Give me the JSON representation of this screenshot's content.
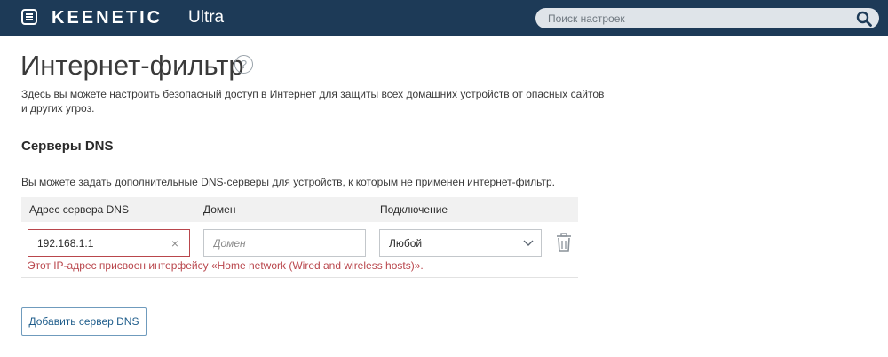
{
  "header": {
    "brand": "KEENETIC",
    "model": "Ultra",
    "search_placeholder": "Поиск настроек",
    "search_value": ""
  },
  "page": {
    "title": "Интернет-фильтр",
    "help_symbol": "?",
    "description": "Здесь вы можете настроить безопасный доступ в Интернет для защиты всех домашних устройств от опасных сайтов и других угроз."
  },
  "dns_section": {
    "title": "Серверы DNS",
    "note": "Вы можете задать дополнительные DNS-серверы для устройств, к которым не применен интернет-фильтр.",
    "columns": [
      "Адрес сервера DNS",
      "Домен",
      "Подключение"
    ],
    "rows": [
      {
        "address_value": "192.168.1.1",
        "domain_value": "",
        "domain_placeholder": "Домен",
        "connection_value": "Любой",
        "error": "Этот IP-адрес присвоен интерфейсу «Home network (Wired and wireless hosts)»."
      }
    ],
    "clear_symbol": "×",
    "add_button_label": "Добавить сервер DNS"
  },
  "colors": {
    "topbar": "#1d3a57",
    "error": "#b9464c",
    "accent": "#1f5d8b"
  },
  "icons": {
    "menu": "menu-icon",
    "search": "search-icon",
    "help": "help-icon",
    "clear": "clear-icon",
    "chevron": "chevron-down-icon",
    "trash": "trash-icon"
  }
}
